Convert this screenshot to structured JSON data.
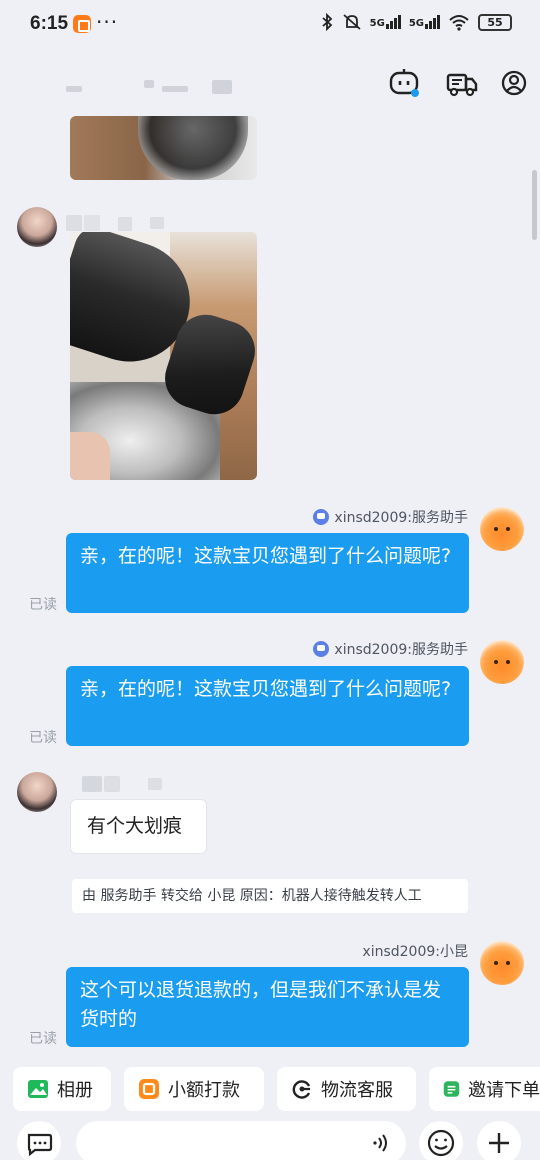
{
  "status_bar": {
    "time": "6:15",
    "dots": "···",
    "network_1": "5G",
    "network_2": "5G",
    "battery": "55"
  },
  "messages": {
    "svc_sender_1": "xinsd2009:服务助手",
    "svc_text_1": "亲，在的呢！这款宝贝您遇到了什么问题呢?",
    "svc_read_1": "已读",
    "svc_sender_2": "xinsd2009:服务助手",
    "svc_text_2": "亲，在的呢！这款宝贝您遇到了什么问题呢?",
    "svc_read_2": "已读",
    "user_text": "有个大划痕",
    "system_note": "由 服务助手 转交给 小昆 原因：机器人接待触发转人工",
    "agent_sender": "xinsd2009:小昆",
    "agent_text": "这个可以退货退款的，但是我们不承认是发货时的",
    "agent_read": "已读"
  },
  "quick_actions": [
    {
      "label": "相册",
      "icon": "album-icon",
      "color": "#1fb85a"
    },
    {
      "label": "小额打款",
      "icon": "payment-icon",
      "color": "#ff8a1a"
    },
    {
      "label": "物流客服",
      "icon": "logistics-service-icon",
      "color": "#222222"
    },
    {
      "label": "邀请下单",
      "icon": "invite-order-icon",
      "color": "#2db55d"
    }
  ],
  "colors": {
    "accent_blue": "#1a9cf0",
    "background": "#eef0f5"
  }
}
